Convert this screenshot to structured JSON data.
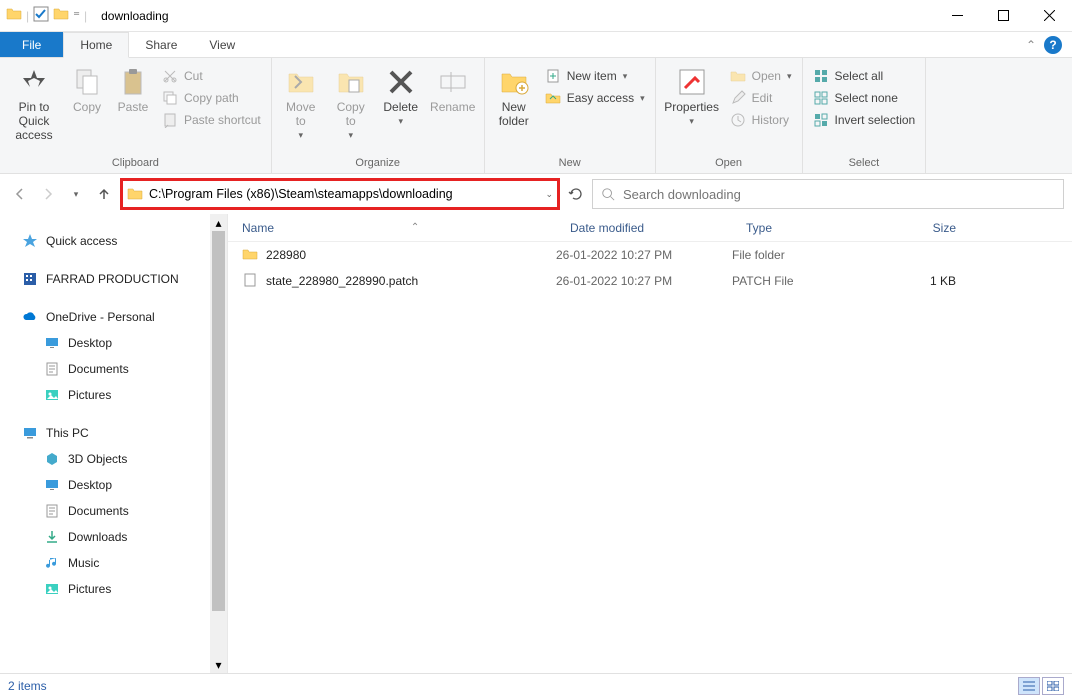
{
  "title": "downloading",
  "menubar": {
    "file": "File",
    "home": "Home",
    "share": "Share",
    "view": "View"
  },
  "ribbon": {
    "clipboard": {
      "label": "Clipboard",
      "pin": "Pin to Quick\naccess",
      "copy": "Copy",
      "paste": "Paste",
      "cut": "Cut",
      "copypath": "Copy path",
      "pasteshortcut": "Paste shortcut"
    },
    "organize": {
      "label": "Organize",
      "moveto": "Move\nto",
      "copyto": "Copy\nto",
      "delete": "Delete",
      "rename": "Rename"
    },
    "new": {
      "label": "New",
      "newfolder": "New\nfolder",
      "newitem": "New item",
      "easyaccess": "Easy access"
    },
    "open": {
      "label": "Open",
      "properties": "Properties",
      "open": "Open",
      "edit": "Edit",
      "history": "History"
    },
    "select": {
      "label": "Select",
      "selectall": "Select all",
      "selectnone": "Select none",
      "invert": "Invert selection"
    }
  },
  "address": "C:\\Program Files (x86)\\Steam\\steamapps\\downloading",
  "search_placeholder": "Search downloading",
  "nav": {
    "quick": "Quick access",
    "farrad": "FARRAD PRODUCTION",
    "onedrive": "OneDrive - Personal",
    "od_desktop": "Desktop",
    "od_documents": "Documents",
    "od_pictures": "Pictures",
    "thispc": "This PC",
    "pc_3d": "3D Objects",
    "pc_desktop": "Desktop",
    "pc_documents": "Documents",
    "pc_downloads": "Downloads",
    "pc_music": "Music",
    "pc_pictures": "Pictures"
  },
  "columns": {
    "name": "Name",
    "date": "Date modified",
    "type": "Type",
    "size": "Size"
  },
  "rows": [
    {
      "icon": "folder",
      "name": "228980",
      "date": "26-01-2022 10:27 PM",
      "type": "File folder",
      "size": ""
    },
    {
      "icon": "file",
      "name": "state_228980_228990.patch",
      "date": "26-01-2022 10:27 PM",
      "type": "PATCH File",
      "size": "1 KB"
    }
  ],
  "status": "2 items"
}
